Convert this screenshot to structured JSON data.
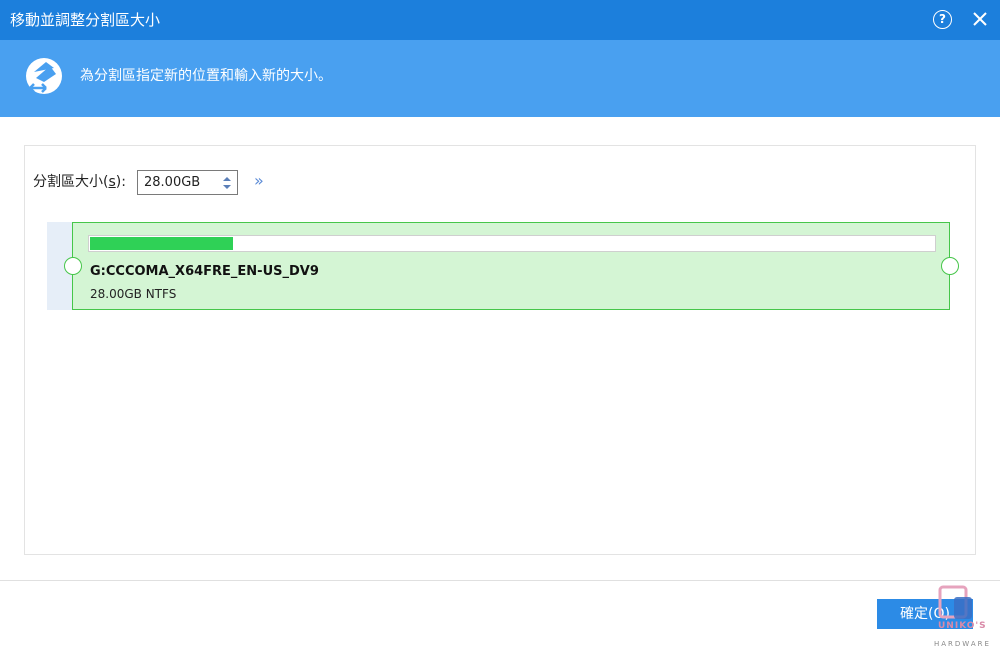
{
  "window": {
    "title": "移動並調整分割區大小",
    "help_glyph": "?",
    "close_icon": "close-icon"
  },
  "banner": {
    "icon": "partition-resize-icon",
    "message": "為分割區指定新的位置和輸入新的大小。"
  },
  "size_field": {
    "label_prefix": "分割區大小(",
    "label_hotkey": "s",
    "label_suffix": "):",
    "value": "28.00GB",
    "expand_glyph": "»"
  },
  "partition": {
    "name": "G:CCCOMA_X64FRE_EN-US_DV9",
    "info": "28.00GB NTFS",
    "used_fraction": 0.17
  },
  "footer": {
    "ok_label": "確定(O)"
  },
  "watermark": {
    "line1": "UNIKO'S",
    "line2": "HARDWARE"
  },
  "colors": {
    "titlebar": "#1c7fdc",
    "banner": "#49a0f0",
    "partition_fill": "#d4f5d4",
    "partition_border": "#46c64a",
    "usage_fill": "#2fd156",
    "ok_button": "#2c8be6"
  }
}
